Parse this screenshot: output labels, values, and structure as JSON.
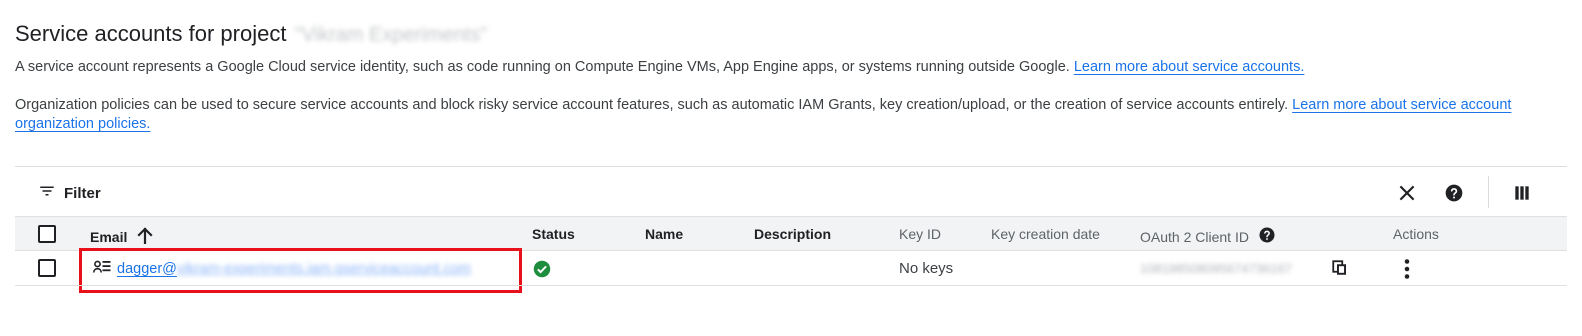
{
  "header": {
    "title": "Service accounts for project",
    "project_name_redacted": "\"Vikram Experiments\""
  },
  "description": {
    "line1": "A service account represents a Google Cloud service identity, such as code running on Compute Engine VMs, App Engine apps, or systems running outside Google.",
    "link1": "Learn more about service accounts.",
    "line2": "Organization policies can be used to secure service accounts and block risky service account features, such as automatic IAM Grants, key creation/upload, or the creation of service accounts entirely.",
    "link2": "Learn more about service account organization policies."
  },
  "toolbar": {
    "filter_label": "Filter",
    "icons": [
      "filter-list-icon",
      "close-icon",
      "help-icon",
      "column-display-icon"
    ]
  },
  "table": {
    "columns": {
      "email": "Email",
      "status": "Status",
      "name": "Name",
      "description": "Description",
      "key_id": "Key ID",
      "key_creation_date": "Key creation date",
      "oauth_client_id": "OAuth 2 Client ID",
      "actions": "Actions"
    },
    "sort": {
      "column": "email",
      "direction": "ascending"
    },
    "rows": [
      {
        "email_prefix": "dagger@",
        "email_rest_redacted": "vikram-experiments.iam.gserviceaccount.com",
        "status": "enabled",
        "name": "",
        "description": "",
        "key_id": "No keys",
        "key_creation_date": "",
        "oauth_client_id_redacted": "108198508095674736167"
      }
    ]
  },
  "colors": {
    "link": "#1a73e8",
    "status_ok": "#1e8e3e",
    "highlight_box": "#e8101a",
    "header_bg": "#f1f3f4"
  }
}
